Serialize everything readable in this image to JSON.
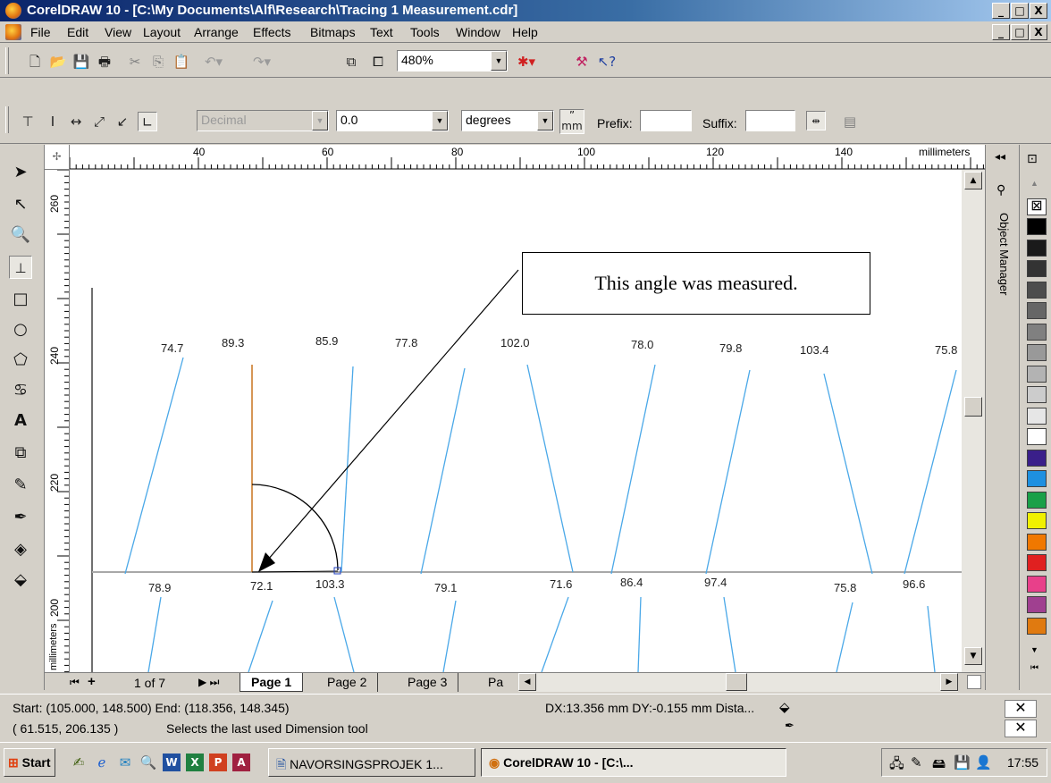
{
  "window": {
    "title": "CorelDRAW 10 - [C:\\My Documents\\Alf\\Research\\Tracing 1 Measurement.cdr]",
    "controls": {
      "minimize": "_",
      "maximize": "□",
      "close": "X"
    }
  },
  "menu": [
    "File",
    "Edit",
    "View",
    "Layout",
    "Arrange",
    "Effects",
    "Bitmaps",
    "Text",
    "Tools",
    "Window",
    "Help"
  ],
  "standard_toolbar": {
    "icons": [
      "new-icon",
      "open-icon",
      "save-icon",
      "print-icon",
      "cut-icon",
      "copy-icon",
      "paste-icon",
      "undo-icon",
      "redo-icon",
      "import-icon",
      "export-icon",
      "corel-online-icon",
      "whats-this-icon"
    ],
    "zoom": "480%"
  },
  "property_bar": {
    "style": "Decimal",
    "precision": "0.0",
    "units": "degrees",
    "units_glyph_top": "”",
    "units_glyph_bottom": "mm",
    "prefix_label": "Prefix:",
    "prefix_value": "",
    "suffix_label": "Suffix:",
    "suffix_value": ""
  },
  "ruler": {
    "horizontal_labels": [
      "40",
      "60",
      "80",
      "100",
      "120",
      "140"
    ],
    "horizontal_unit": "millimeters",
    "vertical_labels": [
      "260",
      "240",
      "220",
      "200"
    ],
    "vertical_unit": "millimeters"
  },
  "drawing": {
    "callout_text": "This angle was measured.",
    "top_measurements": [
      "74.7",
      "89.3",
      "85.9",
      "77.8",
      "102.0",
      "78.0",
      "79.8",
      "103.4",
      "75.8"
    ],
    "bottom_measurements": [
      "78.9",
      "72.1",
      "103.3",
      "79.1",
      "71.6",
      "86.4",
      "97.4",
      "75.8",
      "96.6"
    ],
    "colors": {
      "line": "#4aa8e8",
      "vertical": "#c8741e",
      "baseline": "#a8a8a8"
    }
  },
  "docker": {
    "title": "Object Manager"
  },
  "palette_colors": [
    "#000000",
    "#1a1a1a",
    "#333333",
    "#4d4d4d",
    "#666666",
    "#808080",
    "#999999",
    "#b3b3b3",
    "#cccccc",
    "#e6e6e6",
    "#ffffff",
    "#3a1f8a",
    "#1e90e0",
    "#1aa048",
    "#f0f000",
    "#f07800",
    "#e02020",
    "#e8408a",
    "#a04090",
    "#e07a10"
  ],
  "page_tabs": {
    "counter": "1 of 7",
    "tabs": [
      "Page 1",
      "Page 2",
      "Page 3",
      "Pa"
    ]
  },
  "status": {
    "line1": "Start: (105.000, 148.500)  End: (118.356, 148.345)",
    "delta": "DX:13.356 mm DY:-0.155 mm Dista...",
    "coords": "( 61.515, 206.135 )",
    "hint": "Selects the last used Dimension tool"
  },
  "taskbar": {
    "start": "Start",
    "tasks": [
      "NAVORSINGSPROJEK 1...",
      "CorelDRAW 10 - [C:\\..."
    ],
    "clock": "17:55"
  }
}
